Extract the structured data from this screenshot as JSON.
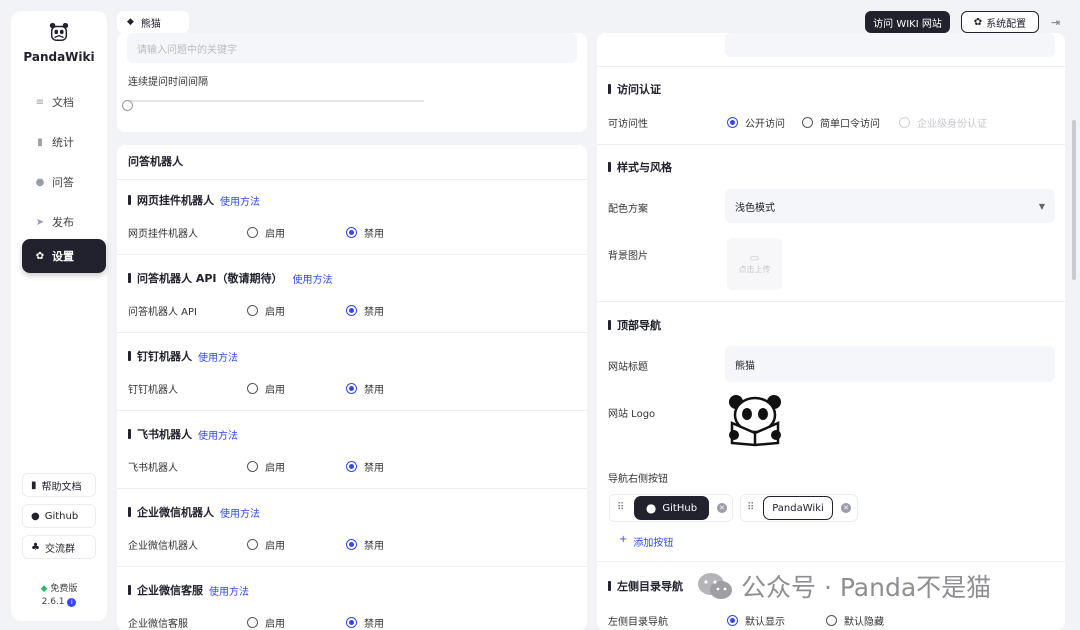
{
  "app": {
    "name": "PandaWiki",
    "plan": "免费版",
    "version": "2.6.1"
  },
  "sidebar": {
    "items": [
      {
        "label": "文档",
        "icon": "docs-icon"
      },
      {
        "label": "统计",
        "icon": "stats-icon"
      },
      {
        "label": "问答",
        "icon": "chat-icon"
      },
      {
        "label": "发布",
        "icon": "publish-icon"
      },
      {
        "label": "设置",
        "icon": "settings-icon",
        "active": true
      }
    ],
    "bottom": [
      {
        "label": "帮助文档",
        "icon": "help-doc-icon"
      },
      {
        "label": "Github",
        "icon": "github-icon"
      },
      {
        "label": "交流群",
        "icon": "group-icon"
      }
    ]
  },
  "header": {
    "kb_name": "熊猫",
    "visit_btn": "访问 WIKI 网站",
    "config_btn": "系统配置"
  },
  "left": {
    "top_placeholder": "请输入问题中的关键字",
    "interval_label": "连续提问时间间隔",
    "slider_value": 0,
    "section_title": "问答机器人",
    "enable_label": "启用",
    "disable_label": "禁用",
    "usage_link": "使用方法",
    "bots": [
      {
        "title": "网页挂件机器人",
        "label": "网页挂件机器人"
      },
      {
        "title": "问答机器人 API（敬请期待）",
        "label": "问答机器人 API"
      },
      {
        "title": "钉钉机器人",
        "label": "钉钉机器人"
      },
      {
        "title": "飞书机器人",
        "label": "飞书机器人"
      },
      {
        "title": "企业微信机器人",
        "label": "企业微信机器人"
      },
      {
        "title": "企业微信客服",
        "label": "企业微信客服"
      }
    ]
  },
  "right": {
    "access": {
      "title": "访问认证",
      "label": "可访问性",
      "options": [
        "公开访问",
        "简单口令访问",
        "企业级身份认证"
      ],
      "selected": "公开访问"
    },
    "style": {
      "title": "样式与风格",
      "scheme_label": "配色方案",
      "scheme_value": "浅色模式",
      "bg_label": "背景图片",
      "upload_text": "点击上传"
    },
    "topnav": {
      "title": "顶部导航",
      "site_title_label": "网站标题",
      "site_title_value": "熊猫",
      "logo_label": "网站 Logo",
      "buttons_label": "导航右侧按钮",
      "buttons": [
        "GitHub",
        "PandaWiki"
      ],
      "add_button": "添加按钮"
    },
    "leftnav": {
      "title": "左侧目录导航",
      "label": "左侧目录导航",
      "options": [
        "默认显示",
        "默认隐藏"
      ],
      "selected": "默认显示"
    }
  },
  "watermark": {
    "text": "公众号 · Panda不是猫"
  },
  "colors": {
    "accent": "#3248f2",
    "dark": "#21222d",
    "bg": "#f2f3f7"
  }
}
